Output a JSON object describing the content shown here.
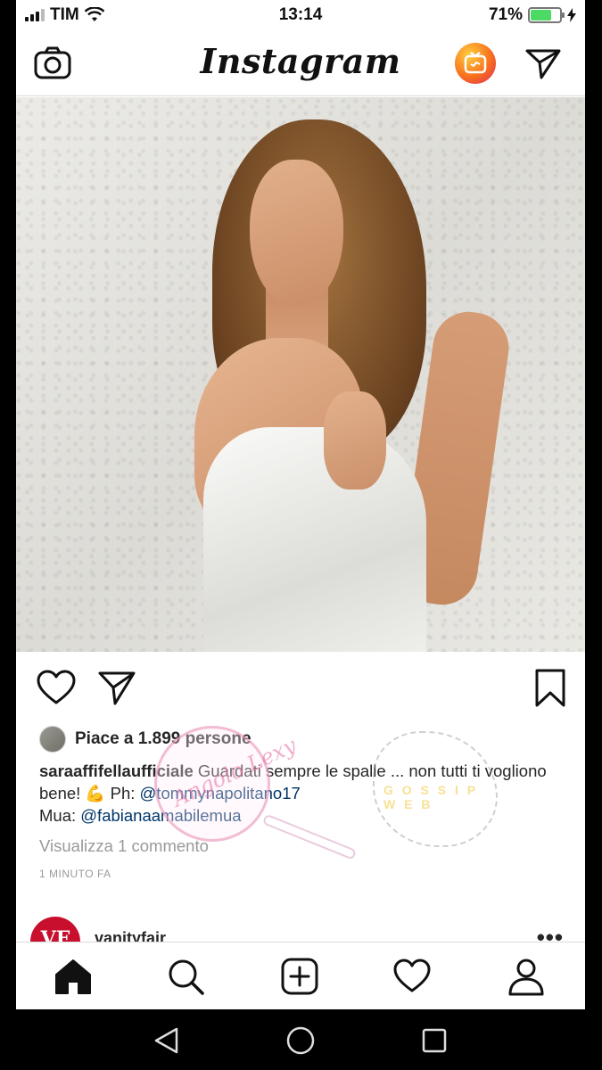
{
  "status_bar": {
    "carrier": "TIM",
    "time": "13:14",
    "battery_text": "71%",
    "battery_level": 0.71,
    "signal_bars_on": 3,
    "signal_bars_total": 4
  },
  "header": {
    "logo": "Instagram",
    "icons": [
      "camera-icon",
      "igtv-icon",
      "direct-send-icon"
    ]
  },
  "post": {
    "likes_text": "Piace a 1.899 persone",
    "caption": {
      "username": "saraaffifellaufficiale",
      "text_1": " Guardati sempre le spalle ... non tutti ti vogliono bene! 💪 Ph: ",
      "mention_1": "@tommynapolitano17",
      "line_2_prefix": "Mua: ",
      "mention_2": "@fabianaamabilemua"
    },
    "view_comments": "Visualizza 1 commento",
    "time_ago": "1 MINUTO FA",
    "actions": [
      "heart-icon",
      "send-icon",
      "bookmark-icon"
    ]
  },
  "next_post": {
    "avatar_text": "VF",
    "username": "vanityfair",
    "more": "•••"
  },
  "watermark": {
    "text": "Angolo Lexy",
    "label": "G O S S I P  W E B"
  },
  "tab_bar": {
    "tabs": [
      "home-icon",
      "search-icon",
      "add-post-icon",
      "activity-heart-icon",
      "profile-icon"
    ],
    "active": "home-icon"
  },
  "android_nav": [
    "back-icon",
    "home-circle-icon",
    "recents-icon"
  ]
}
